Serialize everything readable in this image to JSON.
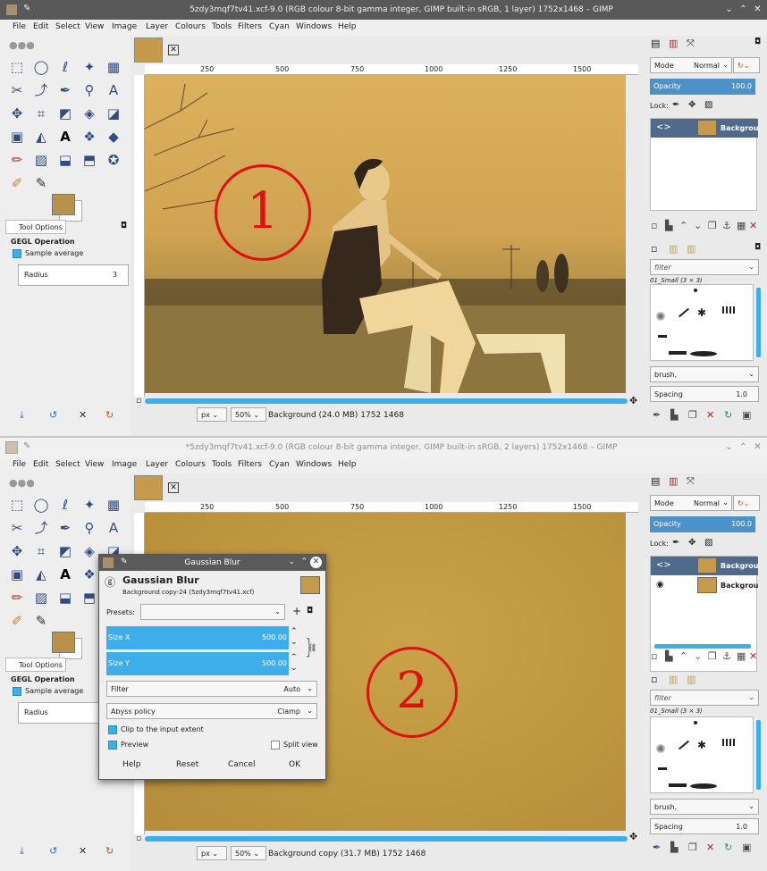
{
  "menu": [
    "File",
    "Edit",
    "Select",
    "View",
    "Image",
    "Layer",
    "Colours",
    "Tools",
    "Filters",
    "Cyan",
    "Windows",
    "Help"
  ],
  "window1": {
    "title": "5zdy3mqf7tv41.xcf-9.0 (RGB colour 8-bit gamma integer, GIMP built-in sRGB, 1 layer) 1752x1468 – GIMP",
    "status_unit": "px",
    "status_zoom": "50%",
    "status_text": "Background (24.0 MB) 1752 1468",
    "annotation": "1",
    "layers": [
      {
        "name": "Background",
        "visible": true,
        "selected": true
      }
    ]
  },
  "window2": {
    "title": "*5zdy3mqf7tv41.xcf-9.0 (RGB colour 8-bit gamma integer, GIMP built-in sRGB, 2 layers) 1752x1468 – GIMP",
    "status_unit": "px",
    "status_zoom": "50%",
    "status_text": "Background copy (31.7 MB) 1752 1468",
    "annotation": "2",
    "layers": [
      {
        "name": "Background c",
        "visible": false,
        "selected": true
      },
      {
        "name": "Background",
        "visible": true,
        "selected": false
      }
    ]
  },
  "ruler_ticks": [
    "250",
    "500",
    "750",
    "1000",
    "1250",
    "1500"
  ],
  "tool_options": {
    "tab": "Tool Options",
    "title": "GEGL Operation",
    "sample_average": "Sample average",
    "radius_label": "Radius",
    "radius_value": "3"
  },
  "layers_dock": {
    "mode_label": "Mode",
    "mode_value": "Normal",
    "opacity_label": "Opacity",
    "opacity_value": "100.0",
    "lock_label": "Lock:"
  },
  "brushes_dock": {
    "filter_placeholder": "filter",
    "brush_set": "01_Small (3 × 3)",
    "brush_tag": "brush,",
    "spacing_label": "Spacing",
    "spacing_value": "1.0"
  },
  "dialog": {
    "title": "Gaussian Blur",
    "heading": "Gaussian Blur",
    "subtitle": "Background copy-24 (5zdy3mqf7tv41.xcf)",
    "presets_label": "Presets:",
    "size_x_label": "Size X",
    "size_x_value": "500.00",
    "size_y_label": "Size Y",
    "size_y_value": "500.00",
    "filter_label": "Filter",
    "filter_value": "Auto",
    "abyss_label": "Abyss policy",
    "abyss_value": "Clamp",
    "clip_label": "Clip to the input extent",
    "preview_label": "Preview",
    "split_label": "Split view",
    "help_button": "Help",
    "reset_button": "Reset",
    "cancel_button": "Cancel",
    "ok_button": "OK"
  },
  "colors": {
    "foreground": "#b8924a",
    "accent": "#3daee9",
    "annotation": "#e01010"
  }
}
